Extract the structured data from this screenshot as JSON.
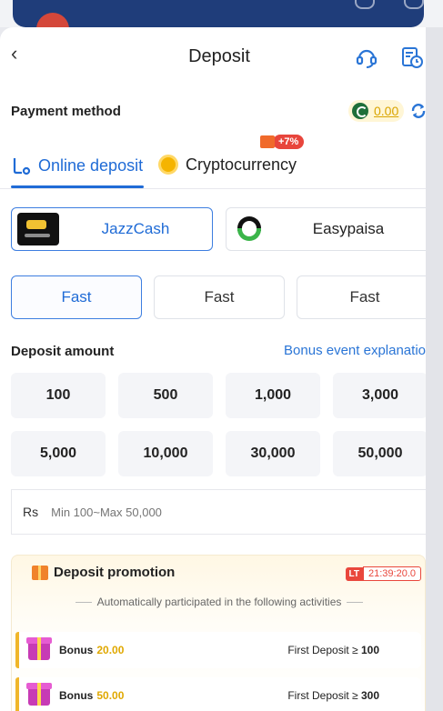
{
  "header": {
    "title": "Deposit"
  },
  "payment": {
    "label": "Payment method",
    "balance": "0.00"
  },
  "tabs": [
    {
      "label": "Online deposit",
      "active": true
    },
    {
      "label": "Cryptocurrency",
      "active": false,
      "badge": "+7%"
    }
  ],
  "methods": [
    {
      "name": "JazzCash",
      "selected": true
    },
    {
      "name": "Easypaisa",
      "selected": false
    }
  ],
  "channels": [
    "Fast",
    "Fast",
    "Fast"
  ],
  "deposit": {
    "label": "Deposit amount",
    "bonus_link": "Bonus event explanatio",
    "amounts": [
      "100",
      "500",
      "1,000",
      "3,000",
      "5,000",
      "10,000",
      "30,000",
      "50,000"
    ],
    "currency": "Rs",
    "placeholder": "Min 100~Max 50,000"
  },
  "promotion": {
    "title": "Deposit promotion",
    "timer_tag": "LT",
    "timer": "21:39:20.0",
    "subtitle": "Automatically participated in the following activities",
    "rows": [
      {
        "label": "Bonus",
        "amount": "20.00",
        "condition": "First Deposit ≥",
        "threshold": "100"
      },
      {
        "label": "Bonus",
        "amount": "50.00",
        "condition": "First Deposit ≥",
        "threshold": "300"
      }
    ]
  },
  "colors": {
    "accent": "#1f6bd6",
    "bonus": "#e0a800",
    "badge": "#e8453c",
    "topbar": "#1f3d7a"
  }
}
